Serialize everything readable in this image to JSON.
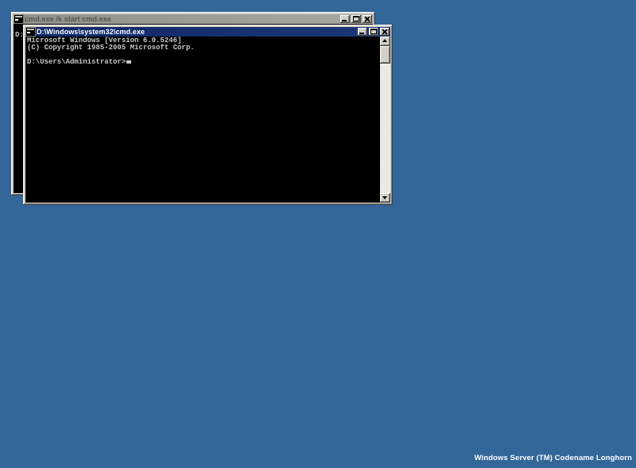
{
  "desktop": {
    "background_color": "#33679A",
    "watermark_text": "Windows Server (TM) Codename Longhorn"
  },
  "back_window": {
    "title": "cmd.exe /k start cmd.exe",
    "state": "inactive",
    "console_text": "\nD:",
    "controls": [
      "minimize",
      "maximize",
      "close"
    ],
    "icon": "cmd-icon"
  },
  "front_window": {
    "title": "D:\\Windows\\system32\\cmd.exe",
    "state": "active",
    "console_text": "Microsoft Windows [Version 6.0.5246]\n(C) Copyright 1985-2005 Microsoft Corp.\n\nD:\\Users\\Administrator>",
    "prompt": "D:\\Users\\Administrator>",
    "os_banner": "Microsoft Windows [Version 6.0.5246]",
    "copyright_line": "(C) Copyright 1985-2005 Microsoft Corp.",
    "controls": [
      "minimize",
      "maximize",
      "close"
    ],
    "icon": "cmd-icon",
    "scrollbar": {
      "orientation": "vertical",
      "thumb_position": "top"
    }
  },
  "colors": {
    "desktop_background": "#33679A",
    "active_titlebar": "#12306F",
    "inactive_titlebar": "#9C9C94",
    "window_chrome": "#D4D0C8",
    "console_background": "#000000",
    "console_text": "#C6C6C6"
  }
}
